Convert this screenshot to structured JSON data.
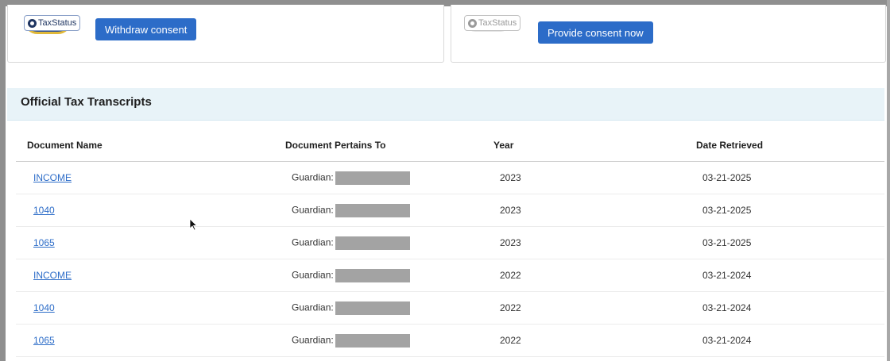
{
  "consent_cards": {
    "left": {
      "logo_text": "TaxStatus",
      "button_label": "Withdraw consent"
    },
    "right": {
      "logo_text": "TaxStatus",
      "button_label": "Provide consent now"
    }
  },
  "section": {
    "title": "Official Tax Transcripts"
  },
  "table": {
    "headers": [
      "Document Name",
      "Document Pertains To",
      "Year",
      "Date Retrieved"
    ],
    "rows": [
      {
        "document": "INCOME",
        "pertains": "Guardian:",
        "year": "2023",
        "date": "03-21-2025"
      },
      {
        "document": "1040",
        "pertains": "Guardian:",
        "year": "2023",
        "date": "03-21-2025"
      },
      {
        "document": "1065",
        "pertains": "Guardian:",
        "year": "2023",
        "date": "03-21-2025"
      },
      {
        "document": "INCOME",
        "pertains": "Guardian:",
        "year": "2022",
        "date": "03-21-2024"
      },
      {
        "document": "1040",
        "pertains": "Guardian:",
        "year": "2022",
        "date": "03-21-2024"
      },
      {
        "document": "1065",
        "pertains": "Guardian:",
        "year": "2022",
        "date": "03-21-2024"
      }
    ]
  },
  "colors": {
    "accent": "#2c6cc8",
    "section_bg": "#e8f3f8",
    "redaction": "#a3a3a3"
  },
  "icons": {
    "logo": "taxstatus-logo-icon",
    "cursor": "mouse-pointer-icon"
  }
}
